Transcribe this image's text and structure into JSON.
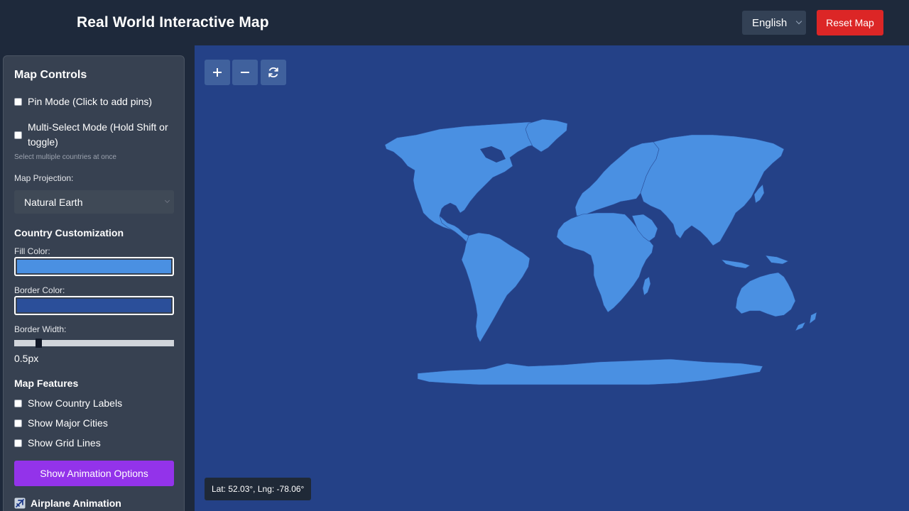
{
  "header": {
    "title": "Real World Interactive Map",
    "language": "English",
    "reset_label": "Reset Map"
  },
  "sidebar": {
    "title": "Map Controls",
    "pin_mode_label": "Pin Mode (Click to add pins)",
    "pin_mode_checked": false,
    "multi_select_label_line1": "Multi-Select Mode (Hold Shift or",
    "multi_select_label_line2": "toggle)",
    "multi_select_checked": false,
    "multi_select_note": "Select multiple countries at once",
    "projection_label": "Map Projection:",
    "projection_value": "Natural Earth",
    "country_section": "Country Customization",
    "fill_label": "Fill Color:",
    "fill_color": "#4a90e2",
    "border_label": "Border Color:",
    "border_color": "#2b4f9a",
    "border_width_label": "Border Width:",
    "border_width_value": "0.5px",
    "features_section": "Map Features",
    "features": [
      {
        "label": "Show Country Labels",
        "checked": false
      },
      {
        "label": "Show Major Cities",
        "checked": false
      },
      {
        "label": "Show Grid Lines",
        "checked": false
      }
    ],
    "animation_button": "Show Animation Options",
    "airplane_label": "Airplane Animation"
  },
  "map": {
    "land_color": "#4a90e2",
    "ocean_color": "#244187",
    "coord_readout": "Lat: 52.03°, Lng: -78.06°"
  }
}
